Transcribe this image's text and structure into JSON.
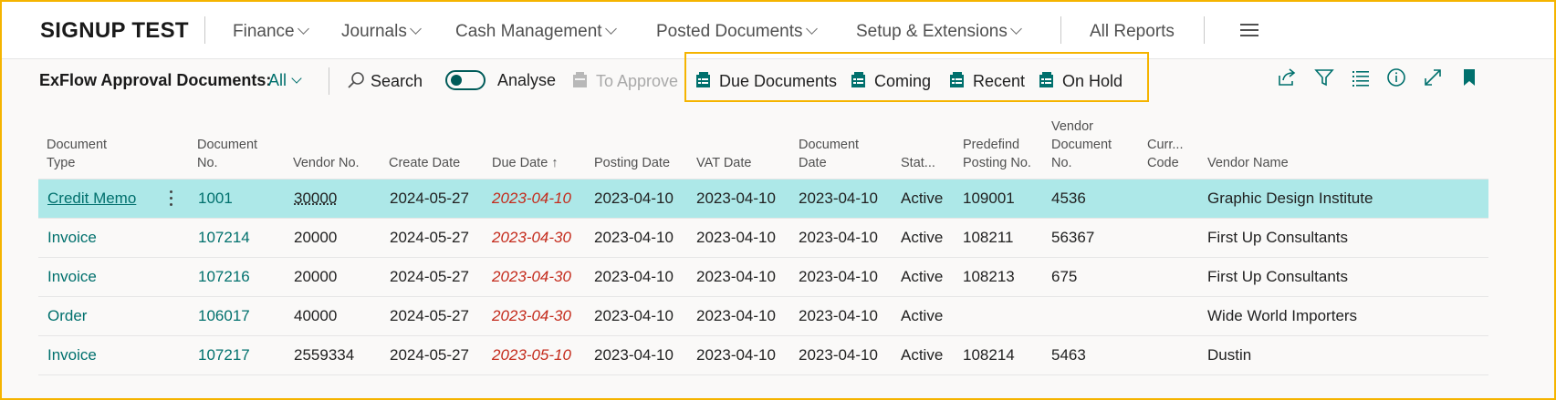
{
  "app": {
    "company": "SIGNUP TEST",
    "nav": [
      "Finance",
      "Journals",
      "Cash Management",
      "Posted Documents",
      "Setup & Extensions"
    ],
    "all_reports": "All Reports"
  },
  "actionbar": {
    "title": "ExFlow Approval Documents:",
    "view": "All",
    "search": "Search",
    "analyse": "Analyse",
    "to_approve": "To Approve",
    "due_documents": "Due Documents",
    "coming": "Coming",
    "recent": "Recent",
    "on_hold": "On Hold",
    "accent": "#00706d",
    "highlight": "#f5b400"
  },
  "table": {
    "headers": {
      "document_type": "Document Type",
      "document_no": "Document No.",
      "vendor_no": "Vendor No.",
      "create_date": "Create Date",
      "due_date": "Due Date",
      "posting_date": "Posting Date",
      "vat_date": "VAT Date",
      "document_date": "Document Date",
      "status": "Stat...",
      "predefined_posting_no": "Predefind Posting No.",
      "vendor_document_no": "Vendor Document No.",
      "currency_code": "Curr... Code",
      "vendor_name": "Vendor Name"
    },
    "rows": [
      {
        "document_type": "Credit Memo",
        "document_no": "1001",
        "vendor_no": "30000",
        "create_date": "2024-05-27",
        "due_date": "2023-04-10",
        "posting_date": "2023-04-10",
        "vat_date": "2023-04-10",
        "document_date": "2023-04-10",
        "status": "Active",
        "predefined_posting_no": "109001",
        "vendor_document_no": "4536",
        "currency_code": "",
        "vendor_name": "Graphic Design Institute"
      },
      {
        "document_type": "Invoice",
        "document_no": "107214",
        "vendor_no": "20000",
        "create_date": "2024-05-27",
        "due_date": "2023-04-30",
        "posting_date": "2023-04-10",
        "vat_date": "2023-04-10",
        "document_date": "2023-04-10",
        "status": "Active",
        "predefined_posting_no": "108211",
        "vendor_document_no": "56367",
        "currency_code": "",
        "vendor_name": "First Up Consultants"
      },
      {
        "document_type": "Invoice",
        "document_no": "107216",
        "vendor_no": "20000",
        "create_date": "2024-05-27",
        "due_date": "2023-04-30",
        "posting_date": "2023-04-10",
        "vat_date": "2023-04-10",
        "document_date": "2023-04-10",
        "status": "Active",
        "predefined_posting_no": "108213",
        "vendor_document_no": "675",
        "currency_code": "",
        "vendor_name": "First Up Consultants"
      },
      {
        "document_type": "Order",
        "document_no": "106017",
        "vendor_no": "40000",
        "create_date": "2024-05-27",
        "due_date": "2023-04-30",
        "posting_date": "2023-04-10",
        "vat_date": "2023-04-10",
        "document_date": "2023-04-10",
        "status": "Active",
        "predefined_posting_no": "",
        "vendor_document_no": "",
        "currency_code": "",
        "vendor_name": "Wide World Importers"
      },
      {
        "document_type": "Invoice",
        "document_no": "107217",
        "vendor_no": "2559334",
        "create_date": "2024-05-27",
        "due_date": "2023-05-10",
        "posting_date": "2023-04-10",
        "vat_date": "2023-04-10",
        "document_date": "2023-04-10",
        "status": "Active",
        "predefined_posting_no": "108214",
        "vendor_document_no": "5463",
        "currency_code": "",
        "vendor_name": "Dustin"
      }
    ]
  }
}
